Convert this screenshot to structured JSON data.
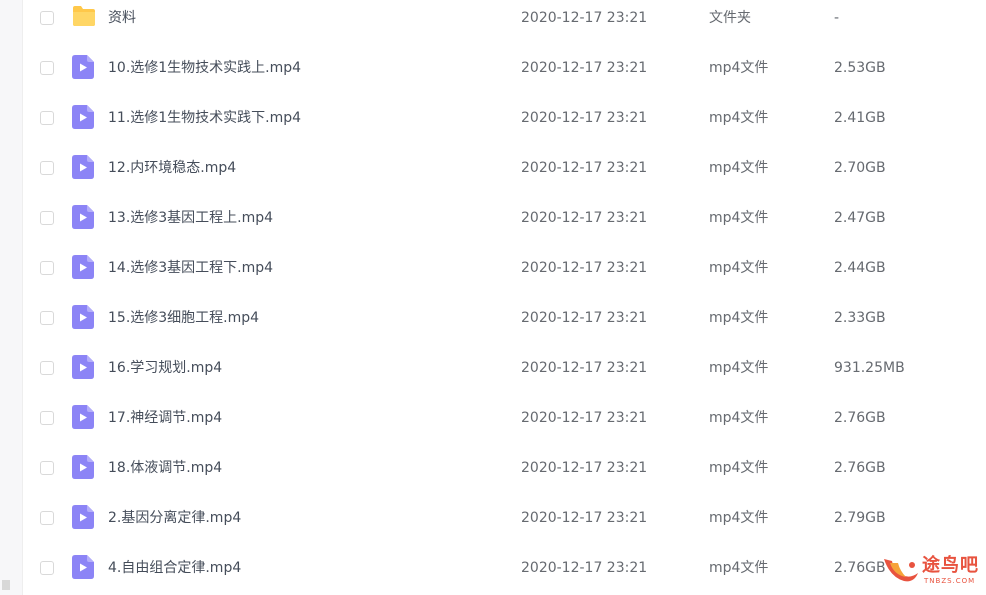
{
  "rows": [
    {
      "name": "资料",
      "date": "2020-12-17 23:21",
      "type": "文件夹",
      "size": "-",
      "icon": "folder-icon"
    },
    {
      "name": "10.选修1生物技术实践上.mp4",
      "date": "2020-12-17 23:21",
      "type": "mp4文件",
      "size": "2.53GB",
      "icon": "video-file-icon"
    },
    {
      "name": "11.选修1生物技术实践下.mp4",
      "date": "2020-12-17 23:21",
      "type": "mp4文件",
      "size": "2.41GB",
      "icon": "video-file-icon"
    },
    {
      "name": "12.内环境稳态.mp4",
      "date": "2020-12-17 23:21",
      "type": "mp4文件",
      "size": "2.70GB",
      "icon": "video-file-icon"
    },
    {
      "name": "13.选修3基因工程上.mp4",
      "date": "2020-12-17 23:21",
      "type": "mp4文件",
      "size": "2.47GB",
      "icon": "video-file-icon"
    },
    {
      "name": "14.选修3基因工程下.mp4",
      "date": "2020-12-17 23:21",
      "type": "mp4文件",
      "size": "2.44GB",
      "icon": "video-file-icon"
    },
    {
      "name": "15.选修3细胞工程.mp4",
      "date": "2020-12-17 23:21",
      "type": "mp4文件",
      "size": "2.33GB",
      "icon": "video-file-icon"
    },
    {
      "name": "16.学习规划.mp4",
      "date": "2020-12-17 23:21",
      "type": "mp4文件",
      "size": "931.25MB",
      "icon": "video-file-icon"
    },
    {
      "name": "17.神经调节.mp4",
      "date": "2020-12-17 23:21",
      "type": "mp4文件",
      "size": "2.76GB",
      "icon": "video-file-icon"
    },
    {
      "name": "18.体液调节.mp4",
      "date": "2020-12-17 23:21",
      "type": "mp4文件",
      "size": "2.76GB",
      "icon": "video-file-icon"
    },
    {
      "name": "2.基因分离定律.mp4",
      "date": "2020-12-17 23:21",
      "type": "mp4文件",
      "size": "2.79GB",
      "icon": "video-file-icon"
    },
    {
      "name": "4.自由组合定律.mp4",
      "date": "2020-12-17 23:21",
      "type": "mp4文件",
      "size": "2.76GB",
      "icon": "video-file-icon"
    }
  ],
  "watermark": {
    "title": "途鸟吧",
    "subtitle": "TNBZS.COM"
  },
  "colors": {
    "folder": "#ffc84a",
    "video_icon": "#8c84f6",
    "text_primary": "#454d5a",
    "text_secondary": "#666a70",
    "watermark": "#e8533f"
  }
}
